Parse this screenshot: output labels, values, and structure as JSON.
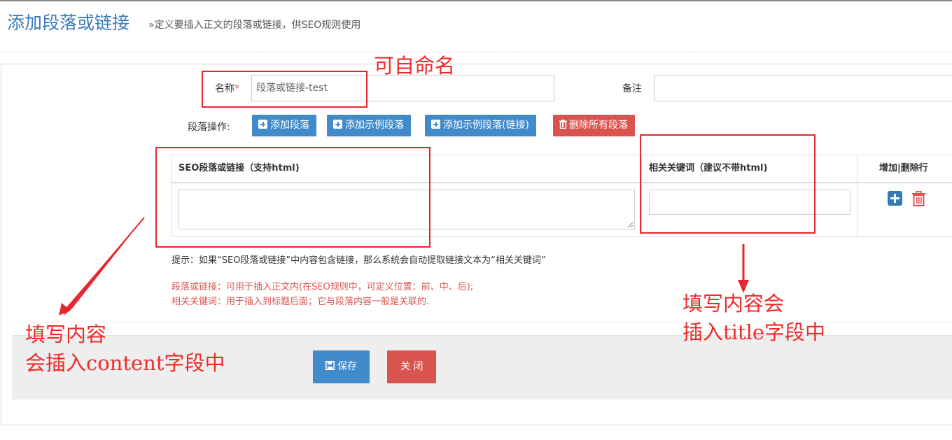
{
  "header": {
    "title": "添加段落或链接",
    "subtitle": "»定义要插入正文的段落或链接，供SEO规则使用"
  },
  "form": {
    "name_label": "名称",
    "name_required_mark": "*",
    "name_value": "段落或链接-test",
    "remark_label": "备注",
    "remark_value": "",
    "ops_label": "段落操作:"
  },
  "buttons": {
    "add_paragraph": "添加段落",
    "add_example": "添加示例段落",
    "add_example_link": "添加示例段落(链接)",
    "delete_all": "删除所有段落",
    "save": "保存",
    "close": "关 闭"
  },
  "table": {
    "col1": "SEO段落或链接（支持html)",
    "col2": "相关关键词（建议不带html)",
    "col3": "增加|删除行",
    "rows": [
      {
        "content": "",
        "keyword": ""
      }
    ]
  },
  "hints": {
    "tip": "提示：如果“SEO段落或链接”中内容包含链接，那么系统会自动提取链接文本为“相关关键词”",
    "note1": "段落或链接：可用于插入正文内(在SEO规则中，可定义位置：前、中、后);",
    "note2": "相关关键词：用于插入到标题后面；它与段落内容一般是关联的."
  },
  "annotations": {
    "rename": "可自命名",
    "content_line1": "填写内容",
    "content_line2": "会插入content字段中",
    "title_line1": "填写内容会",
    "title_line2": "插入title字段中"
  },
  "colors": {
    "primary": "#428bca",
    "danger": "#d9534f",
    "title": "#3a7ab7",
    "annotation": "#e8262e"
  },
  "icons": {
    "add_row": "plus-square-icon",
    "delete_row": "trash-icon",
    "delete_all": "trash-icon",
    "save": "floppy-disk-icon"
  }
}
